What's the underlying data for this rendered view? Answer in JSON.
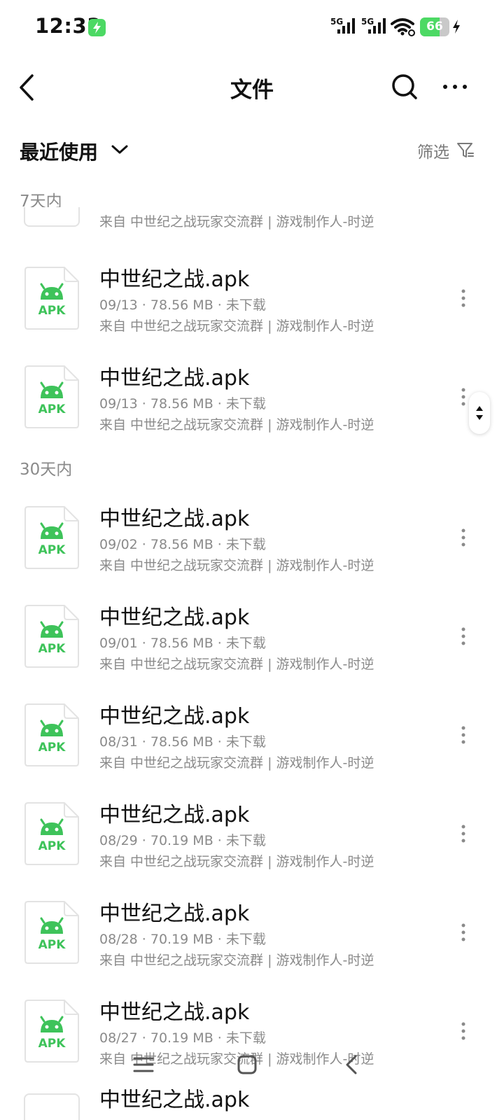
{
  "status_bar": {
    "time": "12:33",
    "signal_1": "5G",
    "signal_2": "5G",
    "battery": "66",
    "battery_color": "#4cd964"
  },
  "header": {
    "title": "文件",
    "back_icon": "back-chevron-icon",
    "search_icon": "search-icon",
    "more_icon": "more-horizontal-icon"
  },
  "sort_bar": {
    "sort_label": "最近使用",
    "filter_label": "筛选"
  },
  "sections": [
    {
      "label": "7天内"
    },
    {
      "label": "30天内"
    }
  ],
  "partial_item": {
    "source": "来自 中世纪之战玩家交流群 | 游戏制作人-时逆"
  },
  "files": [
    {
      "name": "中世纪之战.apk",
      "meta": "09/13 · 78.56 MB · 未下载",
      "source": "来自 中世纪之战玩家交流群 | 游戏制作人-时逆"
    },
    {
      "name": "中世纪之战.apk",
      "meta": "09/13 · 78.56 MB · 未下载",
      "source": "来自 中世纪之战玩家交流群 | 游戏制作人-时逆"
    },
    {
      "name": "中世纪之战.apk",
      "meta": "09/02 · 78.56 MB · 未下载",
      "source": "来自 中世纪之战玩家交流群 | 游戏制作人-时逆"
    },
    {
      "name": "中世纪之战.apk",
      "meta": "09/01 · 78.56 MB · 未下载",
      "source": "来自 中世纪之战玩家交流群 | 游戏制作人-时逆"
    },
    {
      "name": "中世纪之战.apk",
      "meta": "08/31 · 78.56 MB · 未下载",
      "source": "来自 中世纪之战玩家交流群 | 游戏制作人-时逆"
    },
    {
      "name": "中世纪之战.apk",
      "meta": "08/29 · 70.19 MB · 未下载",
      "source": "来自 中世纪之战玩家交流群 | 游戏制作人-时逆"
    },
    {
      "name": "中世纪之战.apk",
      "meta": "08/28 · 70.19 MB · 未下载",
      "source": "来自 中世纪之战玩家交流群 | 游戏制作人-时逆"
    },
    {
      "name": "中世纪之战.apk",
      "meta": "08/27 · 70.19 MB · 未下载",
      "source": "来自 中世纪之战玩家交流群 | 游戏制作人-时逆"
    }
  ],
  "peek_item": {
    "name": "中世纪之战.apk"
  },
  "apk_icon": {
    "label": "APK",
    "color": "#3ec35a"
  },
  "nav_bar": {
    "menu_icon": "menu-icon",
    "home_icon": "home-icon",
    "back_icon": "back-icon"
  }
}
